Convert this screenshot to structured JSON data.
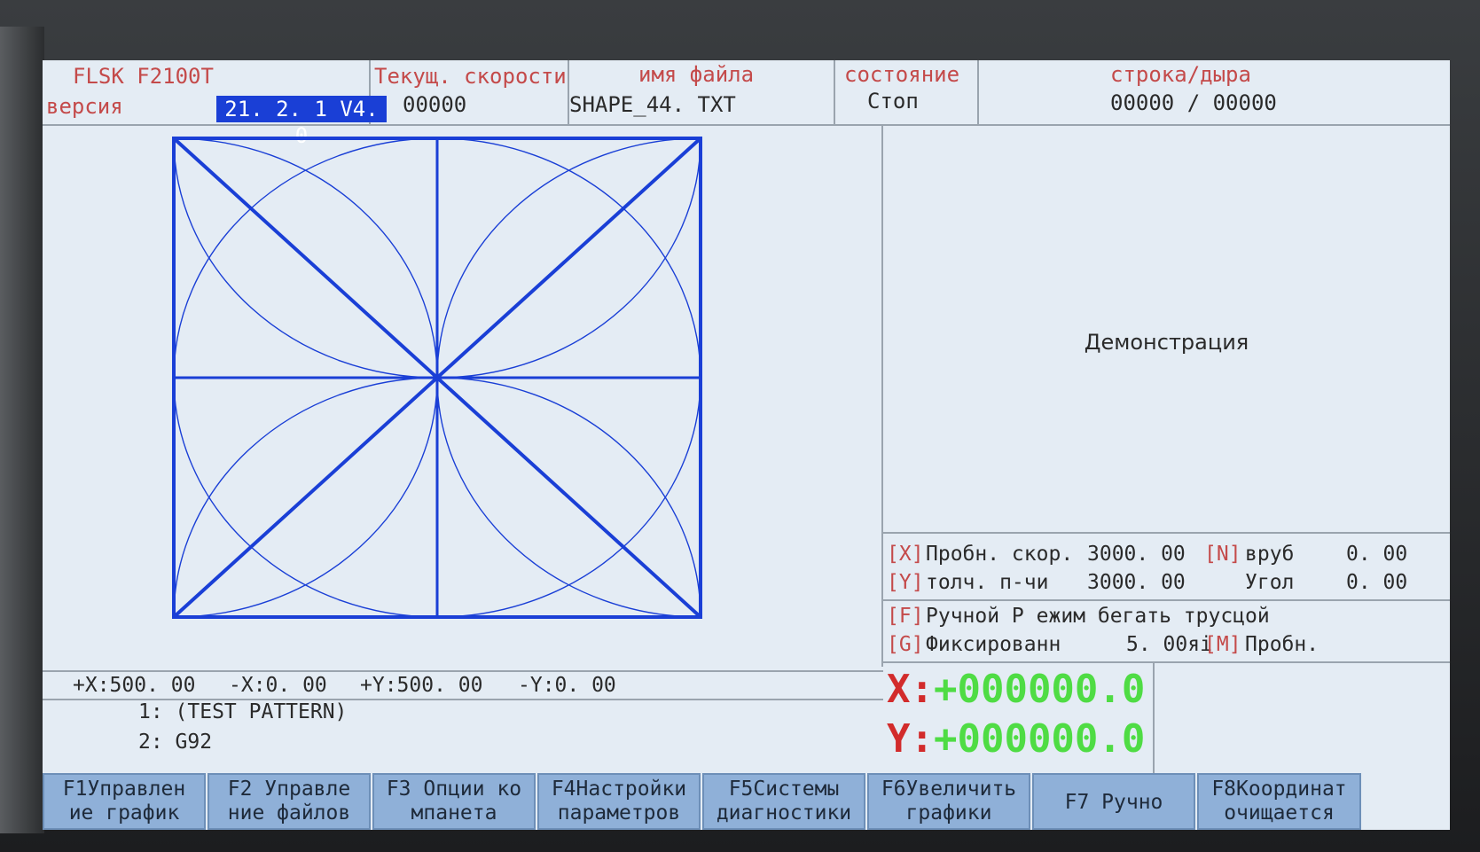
{
  "header": {
    "model": "FLSK F2100T",
    "version_label": "версия",
    "version": "21. 2. 1  V4. 0",
    "speed_label": "Текущ. скорости",
    "speed_value": "00000",
    "filename_label": "имя файла",
    "filename_value": "SHAPE_44. TXT",
    "state_label": "состояние",
    "state_value": "Стоп",
    "line_label": "строка/дыра",
    "line_value": "00000 / 00000"
  },
  "demo_text": "Демонстрация",
  "params": {
    "x_key": "[X]",
    "x_label": "Пробн. скор.",
    "x_value": "3000. 00",
    "n_key": "[N]",
    "n_label": "вруб",
    "n_value": "0. 00",
    "y_key": "[Y]",
    "y_label": "толч. п-чи",
    "y_value": "3000. 00",
    "angle_label": "Угол",
    "angle_value": "0. 00",
    "f_key": "[F]",
    "f_label": "Ручной Р ежим  бегать  трусцой",
    "g_key": "[G]",
    "g_label": "Фиксированн",
    "g_value": "5. 00яі",
    "m_key": "[M]",
    "m_label": "Пробн."
  },
  "coords": {
    "x_label": "X:",
    "x_value": "+000000.0",
    "y_label": "Y:",
    "y_value": "+000000.0"
  },
  "limits": {
    "px": "+X:500. 00",
    "nx": "-X:0. 00",
    "py": "+Y:500. 00",
    "ny": "-Y:0. 00"
  },
  "program": {
    "line1": "1:  (TEST PATTERN)",
    "line2": "2: G92"
  },
  "fkeys": {
    "f1": "F1Управлен\nие график",
    "f2": "F2  Управле\nние файлов",
    "f3": "F3  Опции  ко\nмпанета",
    "f4": "F4Настройки\nпараметров",
    "f5": "F5Системы\nдиагностики",
    "f6": "F6Увеличить\nграфики",
    "f7": "F7  Ручно",
    "f8": "F8Координат\nочищается"
  },
  "colors": {
    "screen_bg": "#e4ecf4",
    "plot_line": "#1a3fd6",
    "version_bg": "#1a3fd6",
    "coord_value": "#4fdc44",
    "coord_key": "#d22b2b",
    "fkey_bg": "#8fb0d8"
  }
}
